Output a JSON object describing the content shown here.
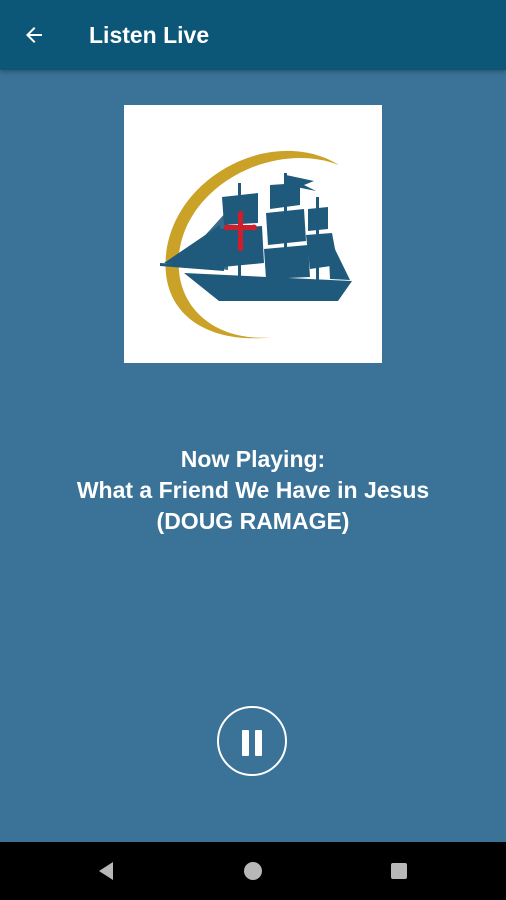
{
  "app_bar": {
    "title": "Listen Live",
    "back_icon": "arrow-left-icon",
    "background": "#0c5777"
  },
  "player": {
    "background": "#3b7297",
    "logo_icon": "sailing-ship-cross-logo",
    "now_playing_label": "Now Playing:",
    "track_title": "What a Friend We Have in Jesus",
    "track_artist": "(DOUG RAMAGE)",
    "state": "playing",
    "pause_icon": "pause-icon"
  },
  "system_nav": {
    "back_icon": "nav-back-triangle-icon",
    "home_icon": "nav-home-circle-icon",
    "recents_icon": "nav-recents-square-icon"
  },
  "colors": {
    "ship_blue": "#1f5a7d",
    "gold_arc": "#c9a227",
    "cross_red": "#cc1f2b"
  }
}
